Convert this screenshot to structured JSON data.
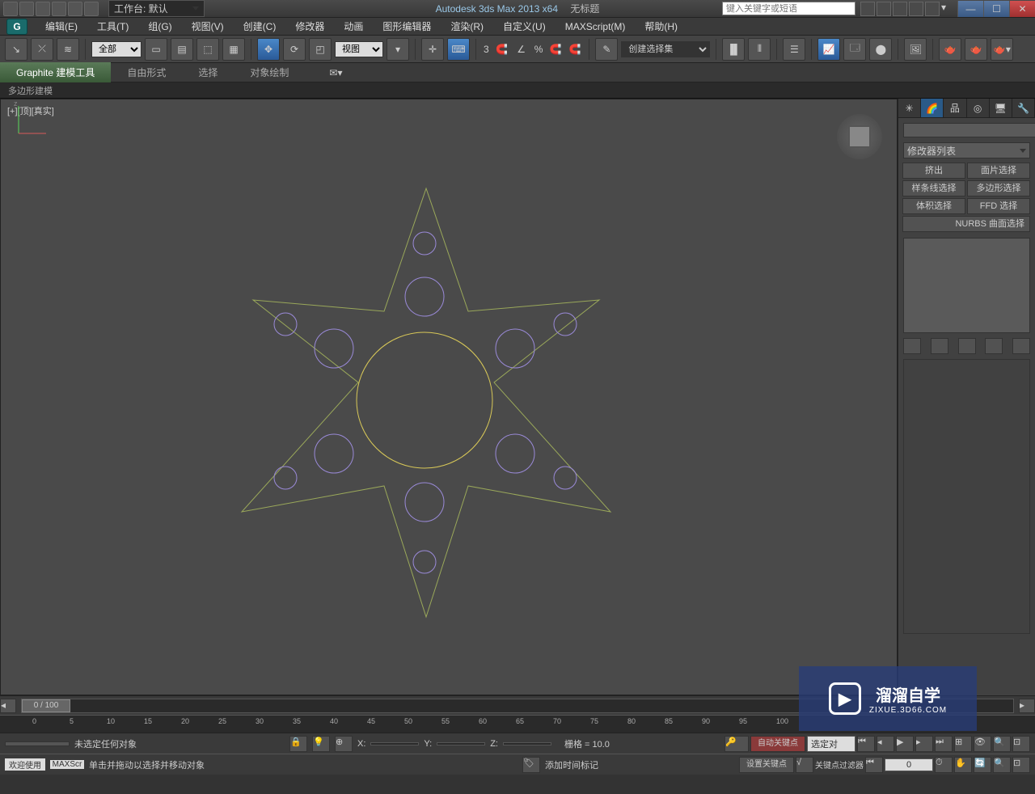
{
  "titlebar": {
    "workspace_label": "工作台: 默认",
    "app_title": "Autodesk 3ds Max  2013 x64",
    "untitled": "无标题",
    "search_placeholder": "键入关键字或短语"
  },
  "menu": {
    "items": [
      "编辑(E)",
      "工具(T)",
      "组(G)",
      "视图(V)",
      "创建(C)",
      "修改器",
      "动画",
      "图形编辑器",
      "渲染(R)",
      "自定义(U)",
      "MAXScript(M)",
      "帮助(H)"
    ]
  },
  "toolbar": {
    "filter_all": "全部",
    "view_combo": "视图",
    "angle_label": "3",
    "percent_label": "%",
    "selset_combo": "创建选择集"
  },
  "ribbon": {
    "tabs": [
      "Graphite 建模工具",
      "自由形式",
      "选择",
      "对象绘制"
    ],
    "sub": "多边形建模"
  },
  "viewport": {
    "label": "[+][顶][真实]"
  },
  "sidepanel": {
    "modlist": "修改器列表",
    "buttons": [
      "挤出",
      "面片选择",
      "样条线选择",
      "多边形选择",
      "体积选择",
      "FFD 选择"
    ],
    "nurbs": "NURBS 曲面选择"
  },
  "timeline": {
    "thumb": "0 / 100",
    "ticks": [
      "0",
      "5",
      "10",
      "15",
      "20",
      "25",
      "30",
      "35",
      "40",
      "45",
      "50",
      "55",
      "60",
      "65",
      "70",
      "75",
      "80",
      "85",
      "90",
      "95",
      "100"
    ]
  },
  "status": {
    "none_selected": "未选定任何对象",
    "x": "X:",
    "y": "Y:",
    "z": "Z:",
    "grid": "栅格 = 10.0",
    "autokey": "自动关键点",
    "selected": "选定对",
    "welcome": "欢迎使用",
    "maxs": "MAXScr",
    "hint": "单击并拖动以选择并移动对象",
    "addtag": "添加时间标记",
    "setkey": "设置关键点",
    "keyfilter": "关键点过滤器",
    "frame": "0"
  },
  "watermark": {
    "main": "溜溜自学",
    "sub": "ZIXUE.3D66.COM"
  }
}
